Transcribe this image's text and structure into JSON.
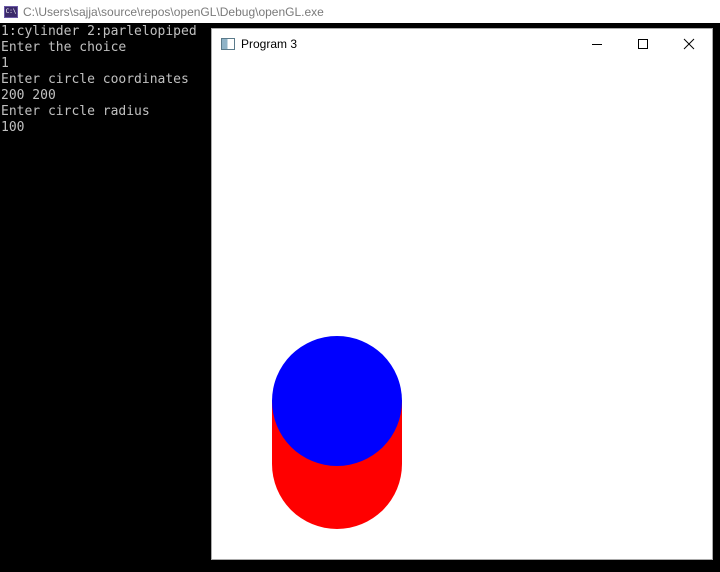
{
  "console": {
    "title": "C:\\Users\\sajja\\source\\repos\\openGL\\Debug\\openGL.exe",
    "icon": "console-app-icon",
    "icon_text": "C:\\",
    "lines": [
      "1:cylinder 2:parlelopiped",
      "Enter the choice",
      "1",
      "Enter circle coordinates",
      "200 200",
      "Enter circle radius",
      "100"
    ]
  },
  "gl_window": {
    "title": "Program 3",
    "icon": "window-app-icon",
    "controls": {
      "minimize": "minimize-icon",
      "maximize": "maximize-icon",
      "close": "close-icon"
    },
    "scene": {
      "shape": "cylinder",
      "body_color": "#ff0000",
      "top_color": "#0000ff",
      "background": "#ffffff"
    }
  }
}
